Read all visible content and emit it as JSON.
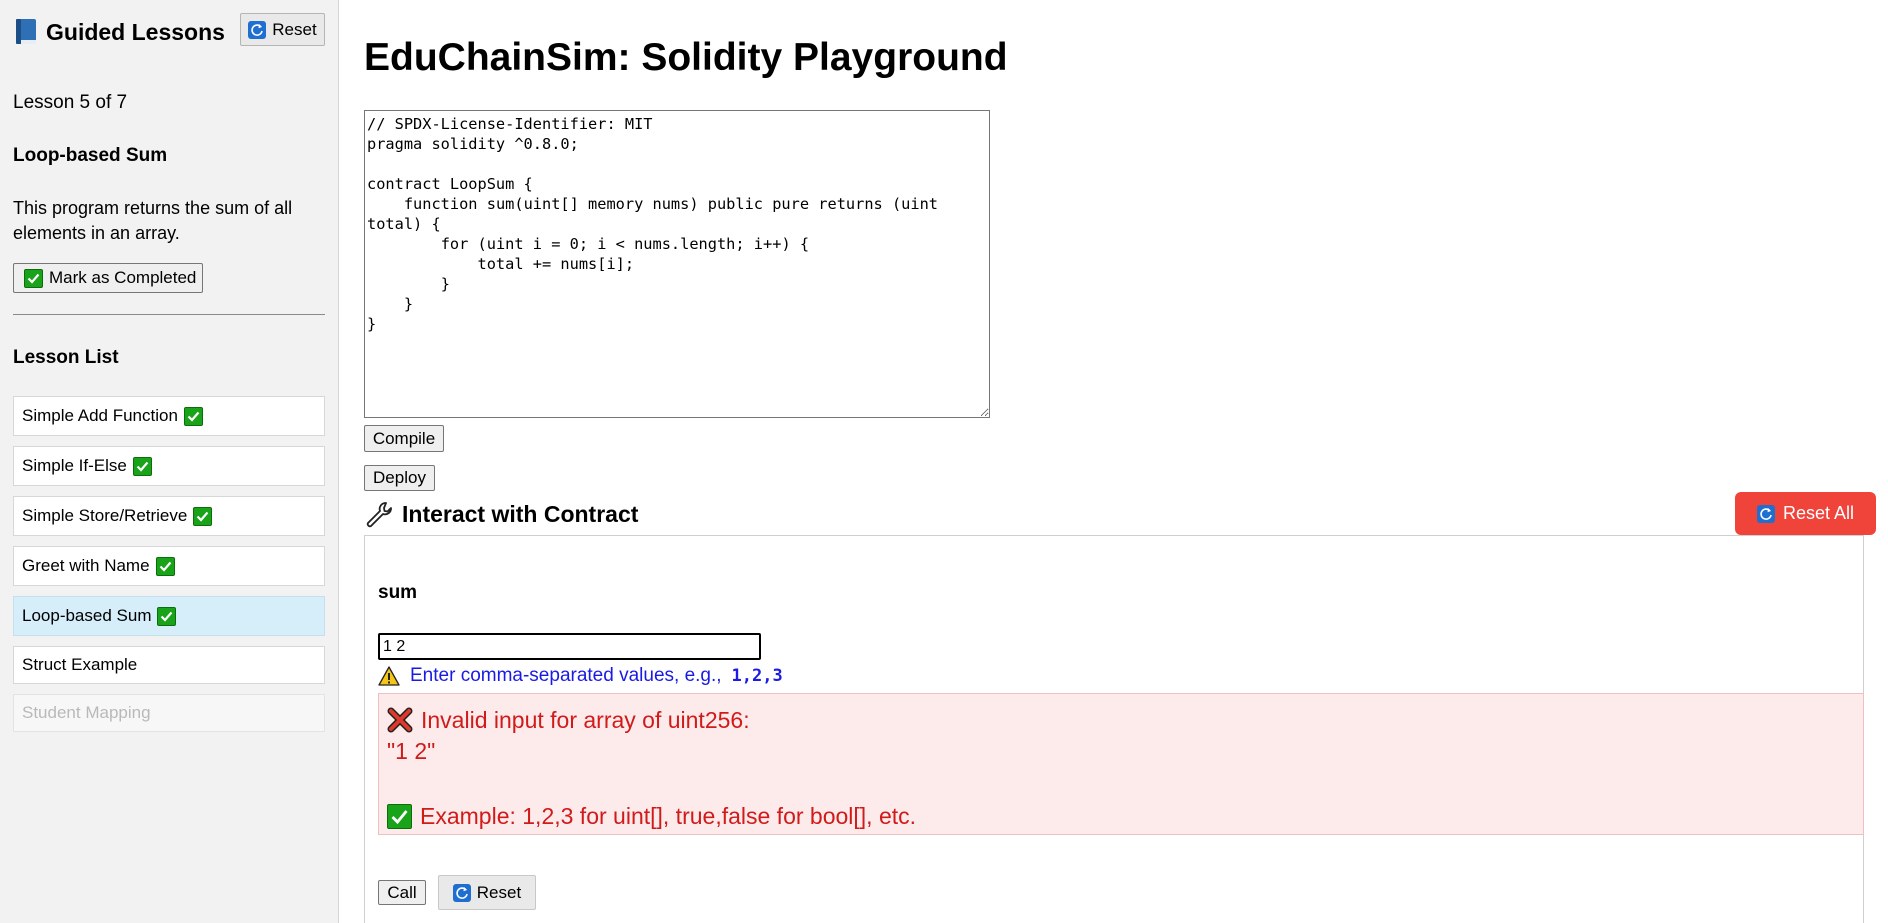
{
  "sidebar": {
    "title": "Guided Lessons",
    "reset_label": "Reset",
    "lesson_counter": "Lesson 5 of 7",
    "current_lesson_title": "Loop-based Sum",
    "current_lesson_description": "This program returns the sum of all elements in an array.",
    "mark_completed_label": "Mark as Completed",
    "lesson_list_heading": "Lesson List",
    "lessons": [
      {
        "label": "Simple Add Function",
        "completed": true,
        "state": "normal"
      },
      {
        "label": "Simple If-Else",
        "completed": true,
        "state": "normal"
      },
      {
        "label": "Simple Store/Retrieve",
        "completed": true,
        "state": "normal"
      },
      {
        "label": "Greet with Name",
        "completed": true,
        "state": "normal"
      },
      {
        "label": "Loop-based Sum",
        "completed": true,
        "state": "active"
      },
      {
        "label": "Struct Example",
        "completed": false,
        "state": "normal"
      },
      {
        "label": "Student Mapping",
        "completed": false,
        "state": "disabled"
      }
    ]
  },
  "main": {
    "title": "EduChainSim: Solidity Playground",
    "code": "// SPDX-License-Identifier: MIT\npragma solidity ^0.8.0;\n\ncontract LoopSum {\n    function sum(uint[] memory nums) public pure returns (uint total) {\n        for (uint i = 0; i < nums.length; i++) {\n            total += nums[i];\n        }\n    }\n}",
    "compile_label": "Compile",
    "deploy_label": "Deploy",
    "interact_title": "Interact with Contract",
    "reset_all_label": "Reset All",
    "function": {
      "name": "sum",
      "input_value": "1 2",
      "hint_text": "Enter comma-separated values, e.g.,",
      "hint_example": "1,2,3",
      "error_title": "Invalid input for array of uint256:",
      "error_value": "\"1 2\"",
      "error_example": "Example: 1,2,3 for uint[], true,false for bool[], etc.",
      "call_label": "Call",
      "reset_label": "Reset"
    }
  },
  "colors": {
    "reset_all_bg": "#f0433a",
    "active_lesson_bg": "#d6eefa",
    "error_text": "#d11a1a",
    "error_bg": "#fdebeb",
    "hint_text": "#1a1ae6",
    "check_green": "#19a319",
    "refresh_blue": "#1f6fd1"
  },
  "icons": {
    "sidebar_title": "book-icon",
    "reset": "refresh-icon",
    "completed": "check-icon",
    "interact": "wrench-icon",
    "hint": "warning-icon",
    "error": "cross-icon"
  }
}
